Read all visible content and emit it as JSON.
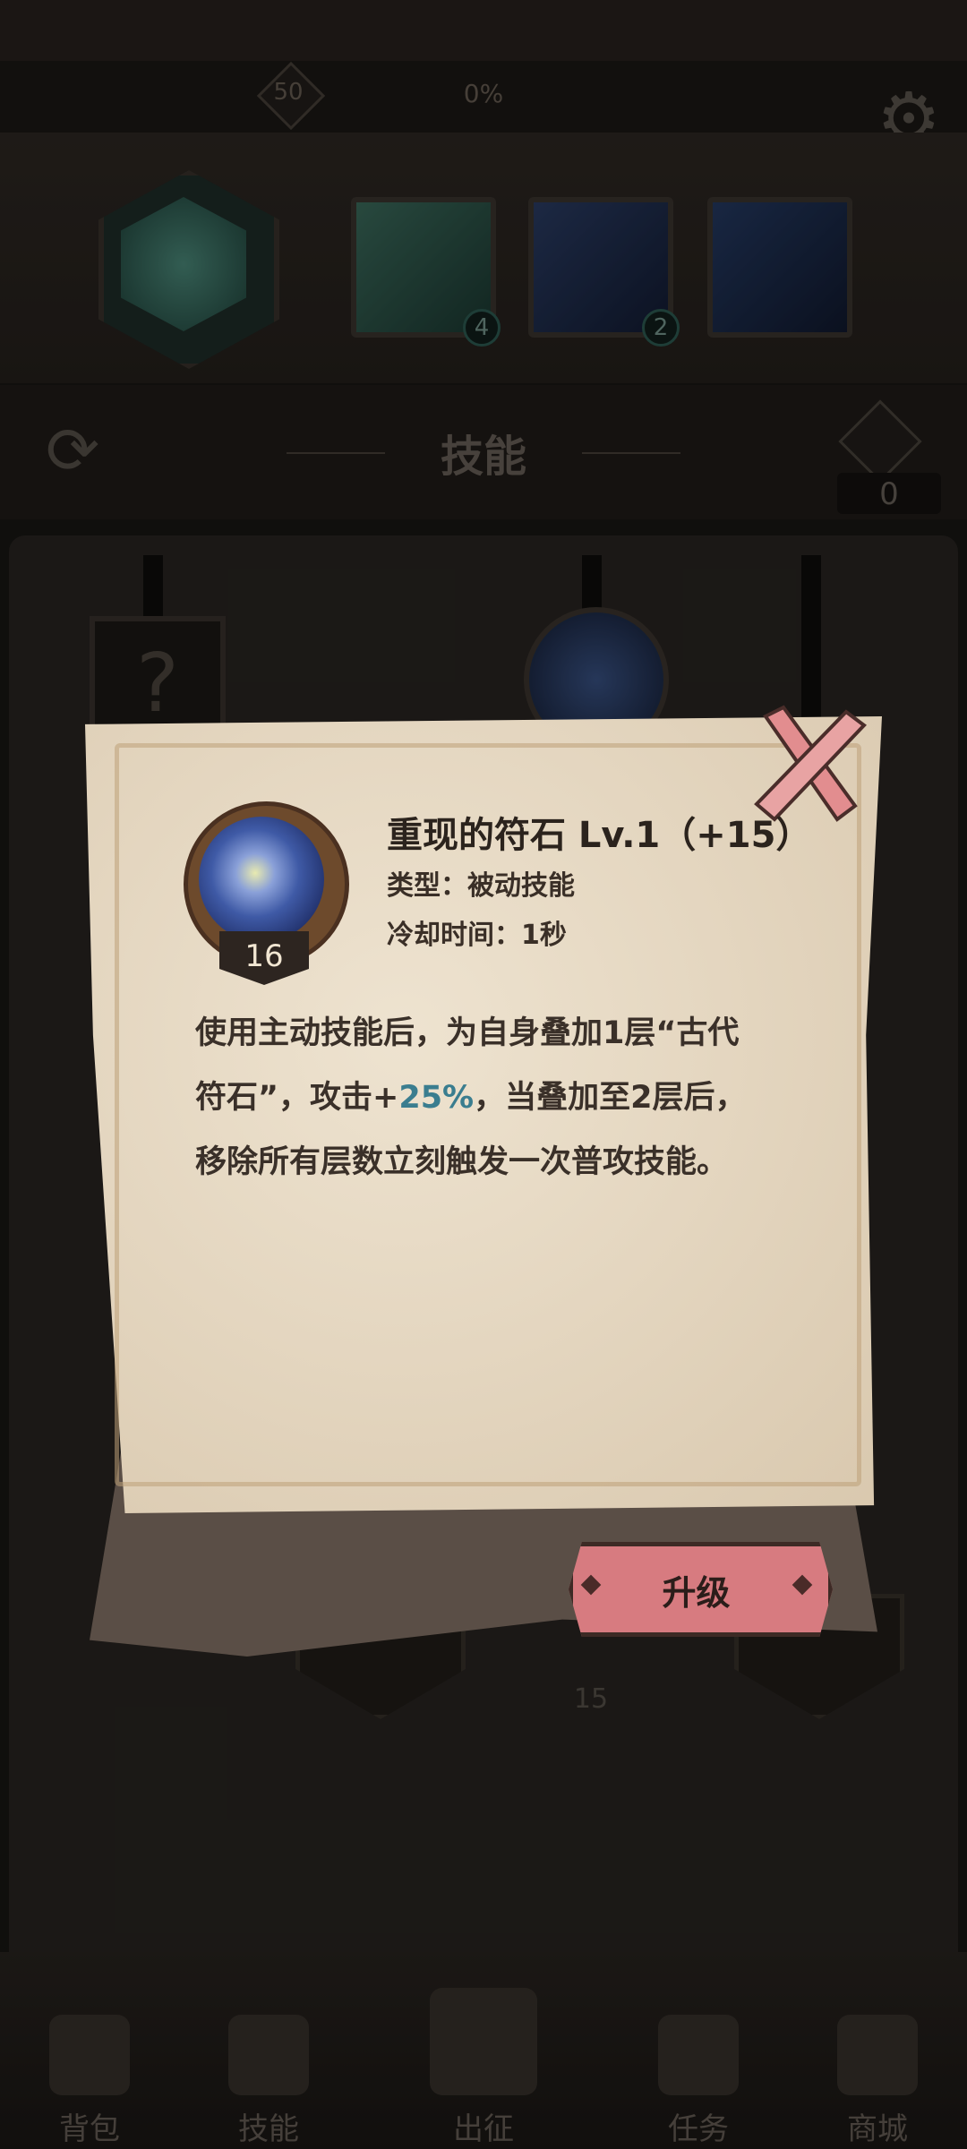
{
  "top": {
    "player_level": "50",
    "progress_text": "0%",
    "settings_icon": "gear-icon"
  },
  "hero_slots": [
    {
      "badge": ""
    },
    {
      "badge": "4"
    },
    {
      "badge": "2"
    },
    {
      "badge": ""
    }
  ],
  "skill_header": {
    "title": "技能",
    "gem_count": "0"
  },
  "tree": {
    "locked_symbol": "?",
    "bottom_node_level": "15"
  },
  "modal": {
    "skill_name": "重现的符石  Lv.1（+15）",
    "type_line": "类型：被动技能",
    "cooldown_line": "冷却时间：1秒",
    "skill_icon_level": "16",
    "description_pre": "使用主动技能后，为自身叠加1层“古代符石”，攻击+",
    "description_highlight": "25%",
    "description_post": "，当叠加至2层后，移除所有层数立刻触发一次普攻技能。",
    "upgrade_label": "升级",
    "highlight_color": "#3a7d8f"
  },
  "nav": {
    "items": [
      {
        "label": "背包",
        "icon": "backpack-icon"
      },
      {
        "label": "技能",
        "icon": "skill-book-icon"
      },
      {
        "label": "出征",
        "icon": "sword-icon"
      },
      {
        "label": "任务",
        "icon": "scroll-icon"
      },
      {
        "label": "商城",
        "icon": "shop-icon"
      }
    ]
  }
}
